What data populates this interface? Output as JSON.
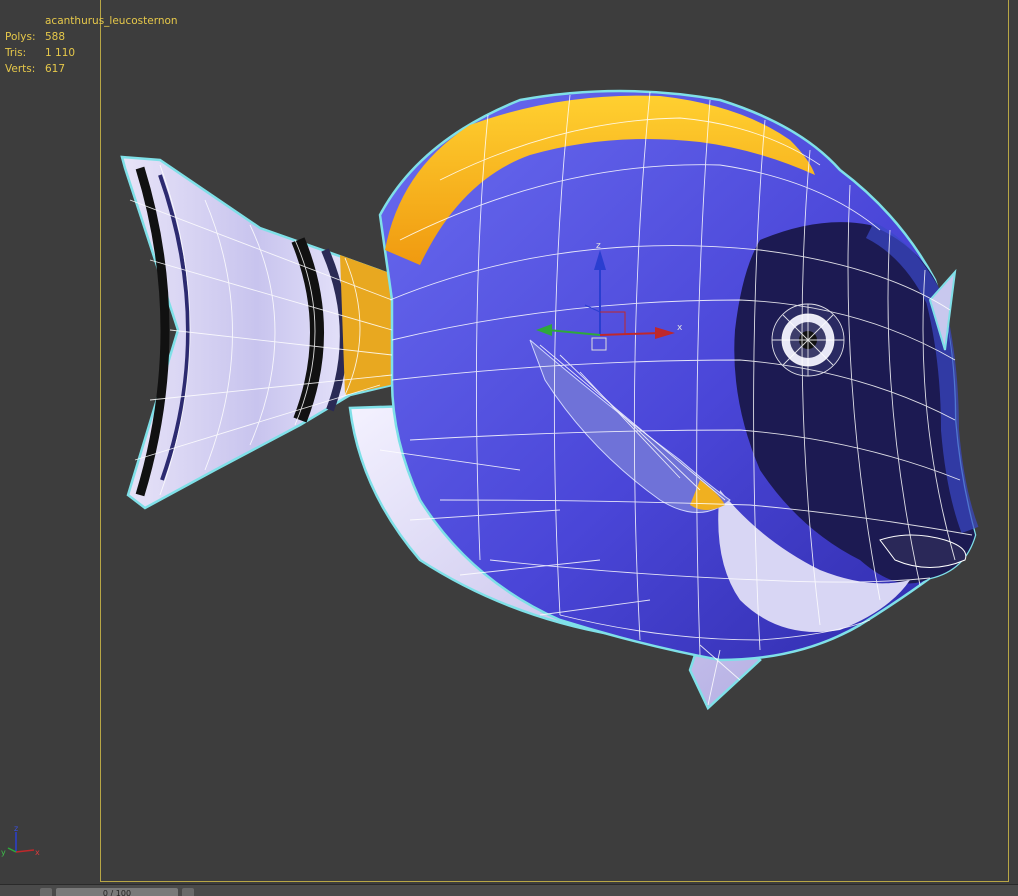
{
  "viewport": {
    "object_name": "acanthurus_leucosternon",
    "stats": [
      {
        "label": "Polys:",
        "value": "588"
      },
      {
        "label": "Tris:",
        "value": "1 110"
      },
      {
        "label": "Verts:",
        "value": "617"
      }
    ],
    "gizmo_axes": {
      "x": "x",
      "y": "y",
      "z": "z"
    },
    "colors": {
      "background": "#3d3d3d",
      "safe_frame": "#b8a645",
      "stats_text": "#e6c84a",
      "selection_outline": "#7fe0e8",
      "wire": "#ffffff",
      "axis_x": "#c0282a",
      "axis_y": "#2ea83a",
      "axis_z": "#2a3ed0"
    }
  },
  "timeline": {
    "slider_label": "0 / 100"
  },
  "icons": {
    "transform_gizmo": "move-gizmo-icon",
    "world_axis": "world-axis-icon"
  }
}
